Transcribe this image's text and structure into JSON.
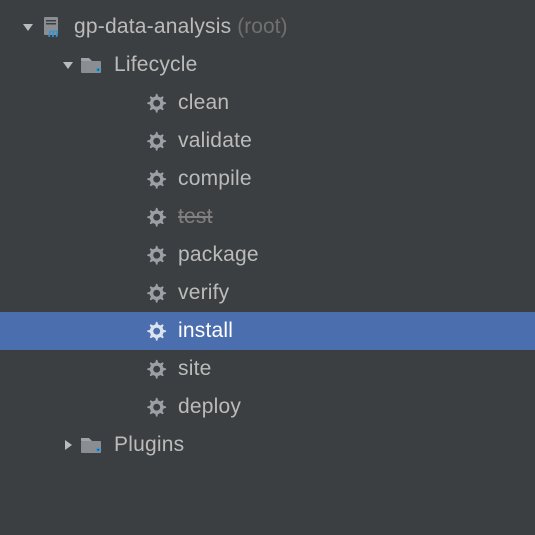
{
  "root": {
    "name": "gp-data-analysis",
    "suffix": "(root)"
  },
  "lifecycle": {
    "label": "Lifecycle",
    "goals": [
      {
        "label": "clean",
        "disabled": false,
        "selected": false
      },
      {
        "label": "validate",
        "disabled": false,
        "selected": false
      },
      {
        "label": "compile",
        "disabled": false,
        "selected": false
      },
      {
        "label": "test",
        "disabled": true,
        "selected": false
      },
      {
        "label": "package",
        "disabled": false,
        "selected": false
      },
      {
        "label": "verify",
        "disabled": false,
        "selected": false
      },
      {
        "label": "install",
        "disabled": false,
        "selected": true
      },
      {
        "label": "site",
        "disabled": false,
        "selected": false
      },
      {
        "label": "deploy",
        "disabled": false,
        "selected": false
      }
    ]
  },
  "plugins": {
    "label": "Plugins"
  }
}
